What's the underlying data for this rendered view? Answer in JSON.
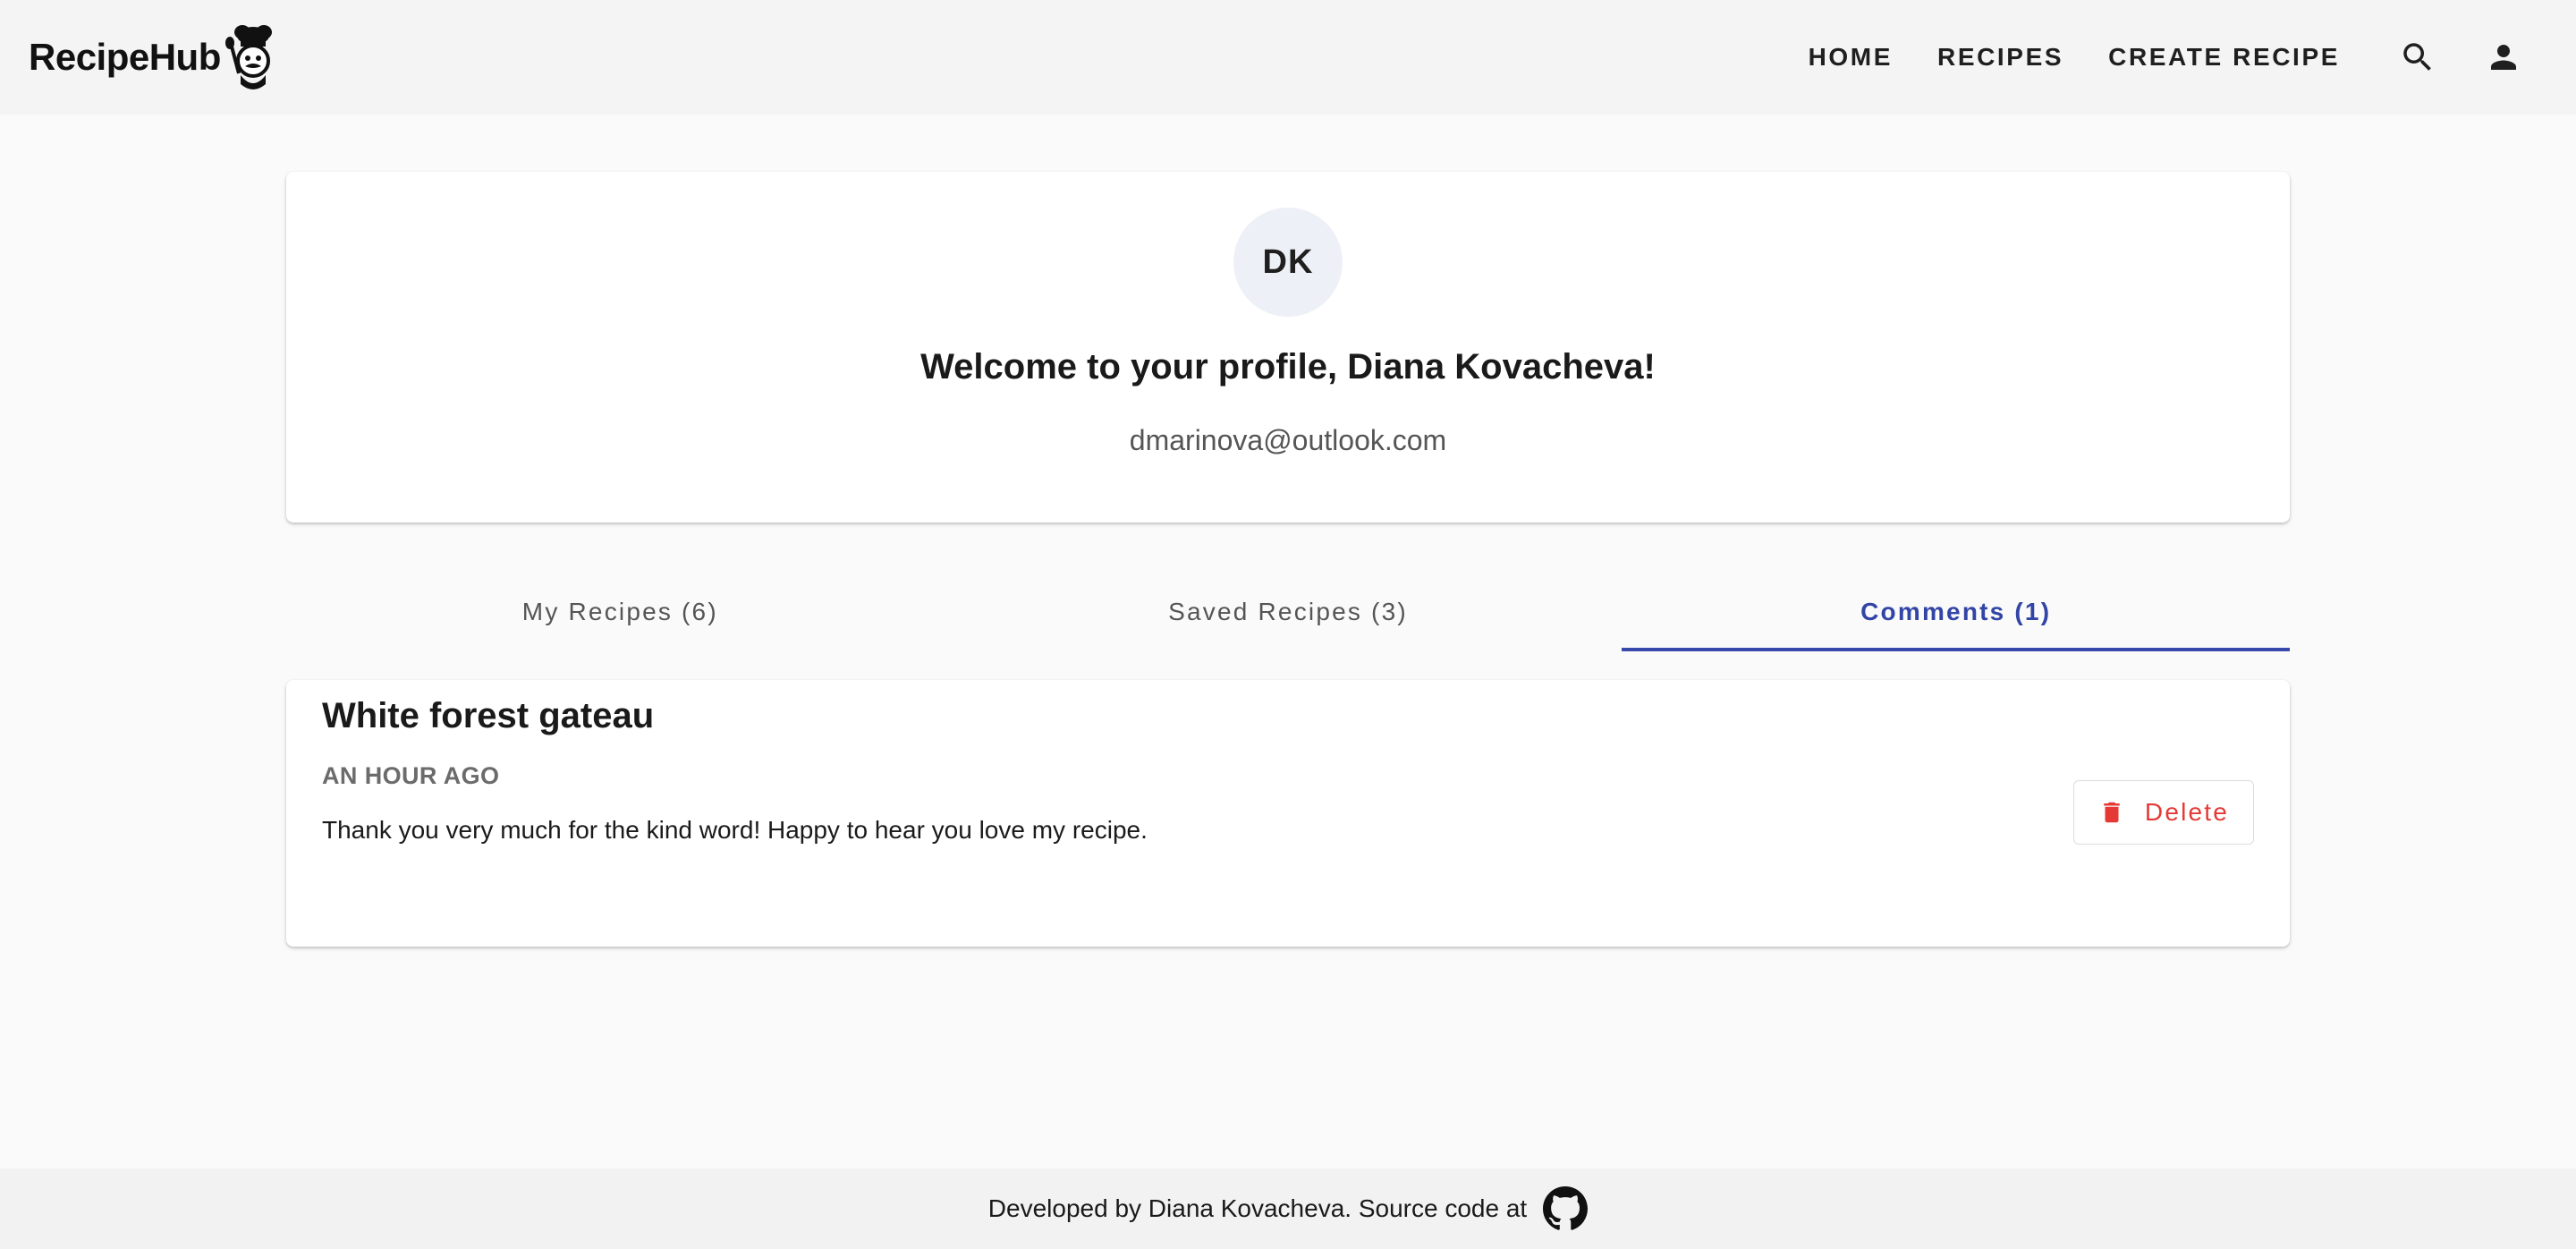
{
  "header": {
    "brand": "RecipeHub",
    "nav": {
      "home": "Home",
      "recipes": "Recipes",
      "create_recipe": "Create Recipe"
    },
    "icons": {
      "search": "search-icon",
      "account": "account-icon",
      "logo": "chef-logo-icon"
    }
  },
  "profile": {
    "initials": "DK",
    "welcome": "Welcome to your profile, Diana Kovacheva!",
    "email": "dmarinova@outlook.com"
  },
  "tabs": [
    {
      "label": "My Recipes (6)",
      "active": false
    },
    {
      "label": "Saved Recipes (3)",
      "active": false
    },
    {
      "label": "Comments (1)",
      "active": true
    }
  ],
  "comments": [
    {
      "recipe_title": "White forest gateau",
      "time": "an hour ago",
      "text": "Thank you very much for the kind word! Happy to hear you love my recipe.",
      "delete_label": "Delete"
    }
  ],
  "footer": {
    "text": "Developed by Diana Kovacheva. Source code at",
    "icon": "github-icon"
  },
  "colors": {
    "accent": "#3949ab",
    "danger": "#e53935",
    "header_bg": "#f4f4f4",
    "page_bg": "#fafafa"
  }
}
